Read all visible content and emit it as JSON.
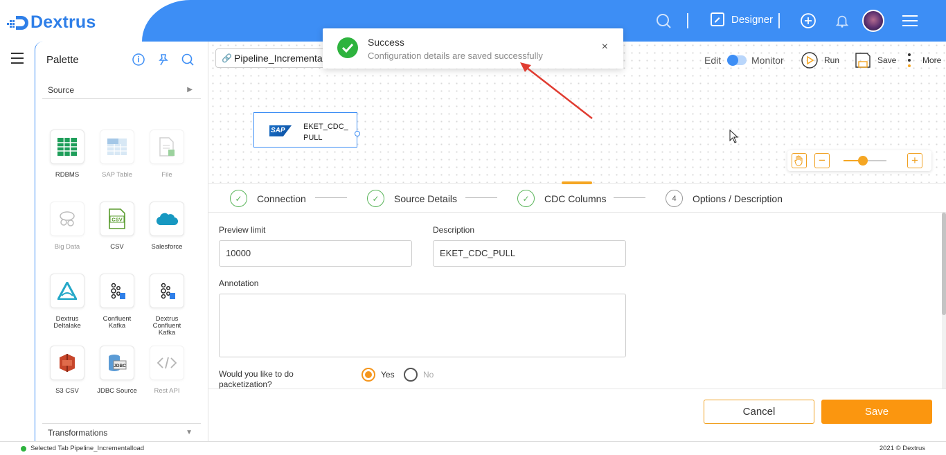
{
  "brand": {
    "name": "Dextrus",
    "color": "#2f7fe8"
  },
  "header": {
    "designer_label": "Designer",
    "icons": [
      "search-icon",
      "edit-icon",
      "add-circle-icon",
      "bell-icon",
      "avatar",
      "hamburger-icon"
    ]
  },
  "palette": {
    "title": "Palette",
    "source_section": "Source",
    "transformations_section": "Transformations",
    "tiles": [
      {
        "label": "RDBMS",
        "icon": "table-grid-icon",
        "enabled": true
      },
      {
        "label": "SAP Table",
        "icon": "sap-table-icon",
        "enabled": false
      },
      {
        "label": "File",
        "icon": "file-icon",
        "enabled": false
      },
      {
        "label": "Big Data",
        "icon": "big-data-icon",
        "enabled": false
      },
      {
        "label": "CSV",
        "icon": "csv-icon",
        "enabled": true
      },
      {
        "label": "Salesforce",
        "icon": "salesforce-cloud-icon",
        "enabled": true
      },
      {
        "label": "Dextrus Deltalake",
        "icon": "deltalake-icon",
        "enabled": true
      },
      {
        "label": "Confluent Kafka",
        "icon": "kafka-icon",
        "enabled": true
      },
      {
        "label": "Dextrus Confluent Kafka",
        "icon": "kafka-icon",
        "enabled": true
      },
      {
        "label": "S3 CSV",
        "icon": "s3-icon",
        "enabled": true
      },
      {
        "label": "JDBC Source",
        "icon": "jdbc-icon",
        "enabled": true
      },
      {
        "label": "Rest API",
        "icon": "code-icon",
        "enabled": false
      }
    ]
  },
  "canvas": {
    "pipeline_name": "Pipeline_Incrementalload",
    "node_label": "EKET_CDC_PULL",
    "node_logo_text": "SAP",
    "mode": {
      "edit": "Edit",
      "monitor": "Monitor"
    },
    "actions": {
      "run": "Run",
      "save": "Save",
      "more": "More"
    }
  },
  "zoom": {
    "level_fraction": 0.45
  },
  "toast": {
    "title": "Success",
    "message": "Configuration details are saved successfully",
    "close": "×"
  },
  "steps": [
    {
      "label": "Connection",
      "state": "done",
      "mark": "✓"
    },
    {
      "label": "Source Details",
      "state": "done",
      "mark": "✓"
    },
    {
      "label": "CDC Columns",
      "state": "done",
      "mark": "✓"
    },
    {
      "label": "Options / Description",
      "state": "current",
      "mark": "4"
    }
  ],
  "form": {
    "preview_limit_label": "Preview limit",
    "preview_limit_value": "10000",
    "description_label": "Description",
    "description_value": "EKET_CDC_PULL",
    "annotation_label": "Annotation",
    "annotation_value": "",
    "packetization_label": "Would you like to do packetization?",
    "packetization_options": [
      {
        "label": "Yes",
        "selected": true
      },
      {
        "label": "No",
        "selected": false
      }
    ]
  },
  "buttons": {
    "cancel": "Cancel",
    "save": "Save"
  },
  "statusbar": {
    "text": "Selected Tab Pipeline_Incrementalload",
    "copyright": "2021 © Dextrus"
  },
  "colors": {
    "accent_blue": "#3d8ef5",
    "accent_orange": "#fb960f",
    "success_green": "#2eb33e"
  }
}
